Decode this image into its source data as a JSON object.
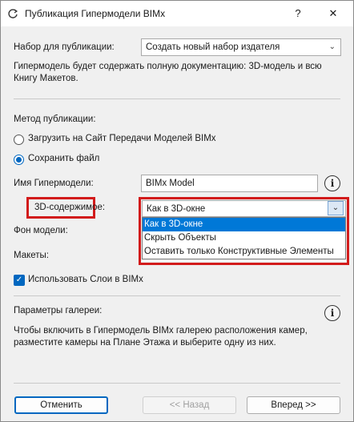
{
  "window": {
    "title": "Публикация Гипермодели BIMx",
    "help_glyph": "?",
    "close_glyph": "✕"
  },
  "publish_set": {
    "label": "Набор для публикации:",
    "value": "Создать новый набор издателя",
    "description_line1": "Гипермодель будет содержать полную документацию: 3D-модель и всю",
    "description_line2": "Книгу Макетов."
  },
  "method": {
    "label": "Метод публикации:",
    "options": [
      {
        "label": "Загрузить на Сайт Передачи Моделей BIMx",
        "selected": false
      },
      {
        "label": "Сохранить файл",
        "selected": true
      }
    ]
  },
  "model_name": {
    "label": "Имя Гипермодели:",
    "value": "BIMx Model"
  },
  "content_3d": {
    "label": "3D-содержимое:",
    "value": "Как в 3D-окне",
    "options": [
      {
        "label": "Как в 3D-окне",
        "highlighted": true
      },
      {
        "label": "Скрыть Объекты",
        "highlighted": false
      },
      {
        "label": "Оставить только Конструктивные Элементы",
        "highlighted": false
      }
    ]
  },
  "background": {
    "label": "Фон модели:"
  },
  "layouts": {
    "label": "Макеты:"
  },
  "use_layers": {
    "label": "Использовать Слои в BIMx",
    "checked": true
  },
  "gallery": {
    "label": "Параметры галереи:",
    "description_line1": "Чтобы включить в Гипермодель BIMx галерею расположения камер,",
    "description_line2": "разместите камеры на Плане Этажа и выберите одну из них."
  },
  "buttons": {
    "cancel": "Отменить",
    "back": "<< Назад",
    "next": "Вперед >>"
  },
  "info_glyph": "i",
  "colors": {
    "accent": "#0067c0",
    "highlight": "#d21b1b",
    "selection": "#0078d7"
  }
}
